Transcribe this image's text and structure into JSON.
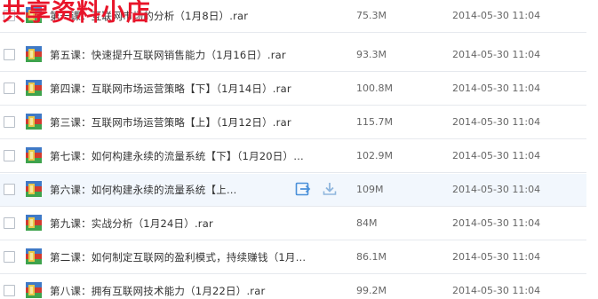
{
  "watermark": "共享资料小店",
  "files": [
    {
      "name": "第一课：互联网市场的分析（1月8日）.rar",
      "size": "75.3M",
      "date": "2014-05-30 11:04"
    },
    {
      "name": "第五课：快速提升互联网销售能力（1月16日）.rar",
      "size": "93.3M",
      "date": "2014-05-30 11:04"
    },
    {
      "name": "第四课：互联网市场运营策略【下】（1月14日）.rar",
      "size": "100.8M",
      "date": "2014-05-30 11:04"
    },
    {
      "name": "第三课：互联网市场运营策略【上】（1月12日）.rar",
      "size": "115.7M",
      "date": "2014-05-30 11:04"
    },
    {
      "name": "第七课：如何构建永续的流量系统【下】（1月20日）…",
      "size": "102.9M",
      "date": "2014-05-30 11:04"
    },
    {
      "name": "第六课：如何构建永续的流量系统【上…",
      "size": "109M",
      "date": "2014-05-30 11:04"
    },
    {
      "name": "第九课：实战分析（1月24日）.rar",
      "size": "84M",
      "date": "2014-05-30 11:04"
    },
    {
      "name": "第二课：如何制定互联网的盈利模式，持续赚钱（1月…",
      "size": "86.1M",
      "date": "2014-05-30 11:04"
    },
    {
      "name": "第八课：拥有互联网技术能力（1月22日）.rar",
      "size": "99.2M",
      "date": "2014-05-30 11:04"
    }
  ],
  "hovered_row": 5,
  "icons": {
    "file": "archive-file-icon",
    "share": "share-icon",
    "download": "download-icon"
  },
  "colors": {
    "watermark": "#e8152a",
    "hover_row": "#f2f7fd",
    "action_icon": "#4a90d9"
  }
}
